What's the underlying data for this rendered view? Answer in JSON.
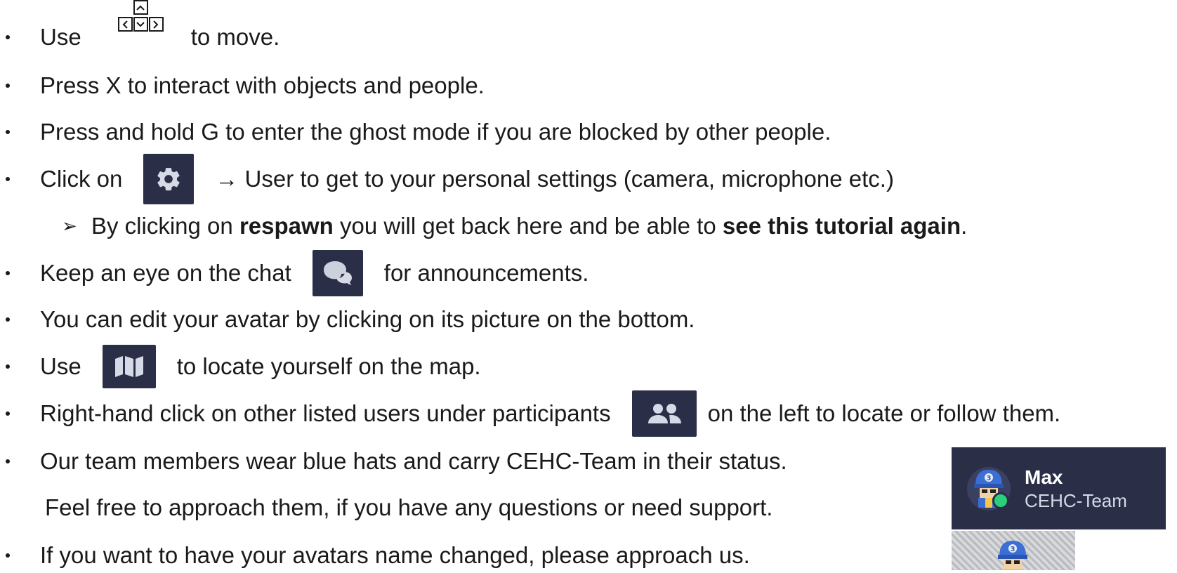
{
  "tutorial": {
    "line1": {
      "prefix": "Use",
      "suffix": "to move."
    },
    "line2": {
      "text": "Press X to interact with objects and people."
    },
    "line3": {
      "text": "Press and hold G to enter the ghost mode if you are blocked by other people."
    },
    "line4": {
      "prefix": "Click on",
      "suffix": "→ User to get to your personal settings (camera, microphone etc.)"
    },
    "subline": {
      "marker": "➢",
      "part1": "By clicking on ",
      "bold1": "respawn",
      "part2": " you will get back here and be able to ",
      "bold2": "see this tutorial again",
      "part3": "."
    },
    "line5": {
      "prefix": "Keep an eye on the chat",
      "suffix": "for announcements."
    },
    "line6": {
      "text": "You can edit your avatar by clicking on its picture on the bottom."
    },
    "line7": {
      "prefix": "Use",
      "suffix": "to locate yourself on the map."
    },
    "line8": {
      "prefix": "Right-hand click on other listed users under participants",
      "suffix": "on the left to locate or follow them."
    },
    "line9": {
      "text": "Our team members wear blue hats and carry CEHC-Team in their status."
    },
    "line9b": {
      "text": "Feel free to approach them, if you have any questions or need support."
    },
    "line10": {
      "text": "If you want to have your avatars name changed, please approach us."
    }
  },
  "profile_card": {
    "name": "Max",
    "status": "CEHC-Team",
    "online_color": "#2bd07a",
    "avatar_hat_color": "#3b6fd6",
    "avatar_number": "3"
  },
  "colors": {
    "icon_background": "#2a2f47",
    "icon_glyph": "#d6d9e6",
    "text": "#1a1a1a"
  },
  "icons": {
    "move_keys": "arrow-keys-icon",
    "settings": "gear-icon",
    "chat": "chat-bubbles-icon",
    "map": "map-icon",
    "participants": "participants-icon"
  }
}
